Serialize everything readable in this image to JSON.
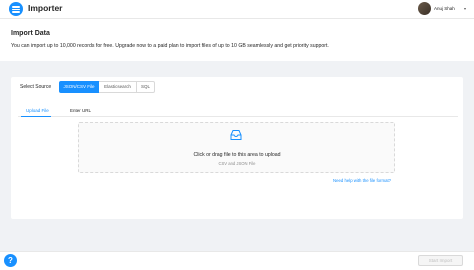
{
  "app": {
    "title": "Importer"
  },
  "user": {
    "name": "Anuj Shah",
    "caret": "▾"
  },
  "header": {
    "title": "Import Data",
    "description": "You can import up to 10,000 records for free. Upgrade now to a paid plan to import files of up to 10 GB seamlessly and get priority support."
  },
  "source": {
    "label": "Select Source",
    "options": [
      "JSON/CSV File",
      "Elasticsearch",
      "SQL"
    ],
    "selected": "JSON/CSV File"
  },
  "tabs": [
    {
      "label": "Upload File",
      "active": true
    },
    {
      "label": "Enter URL",
      "active": false
    }
  ],
  "dropzone": {
    "icon": "inbox-icon",
    "text": "Click or drag file to this area to upload",
    "hint": "CSV and JSON File"
  },
  "help_link": "Need help with the file format?",
  "footer": {
    "help_icon": "?",
    "start_button": "Start Import"
  },
  "colors": {
    "accent": "#1890ff",
    "background": "#f0f2f5",
    "disabled": "#bfbfbf"
  }
}
